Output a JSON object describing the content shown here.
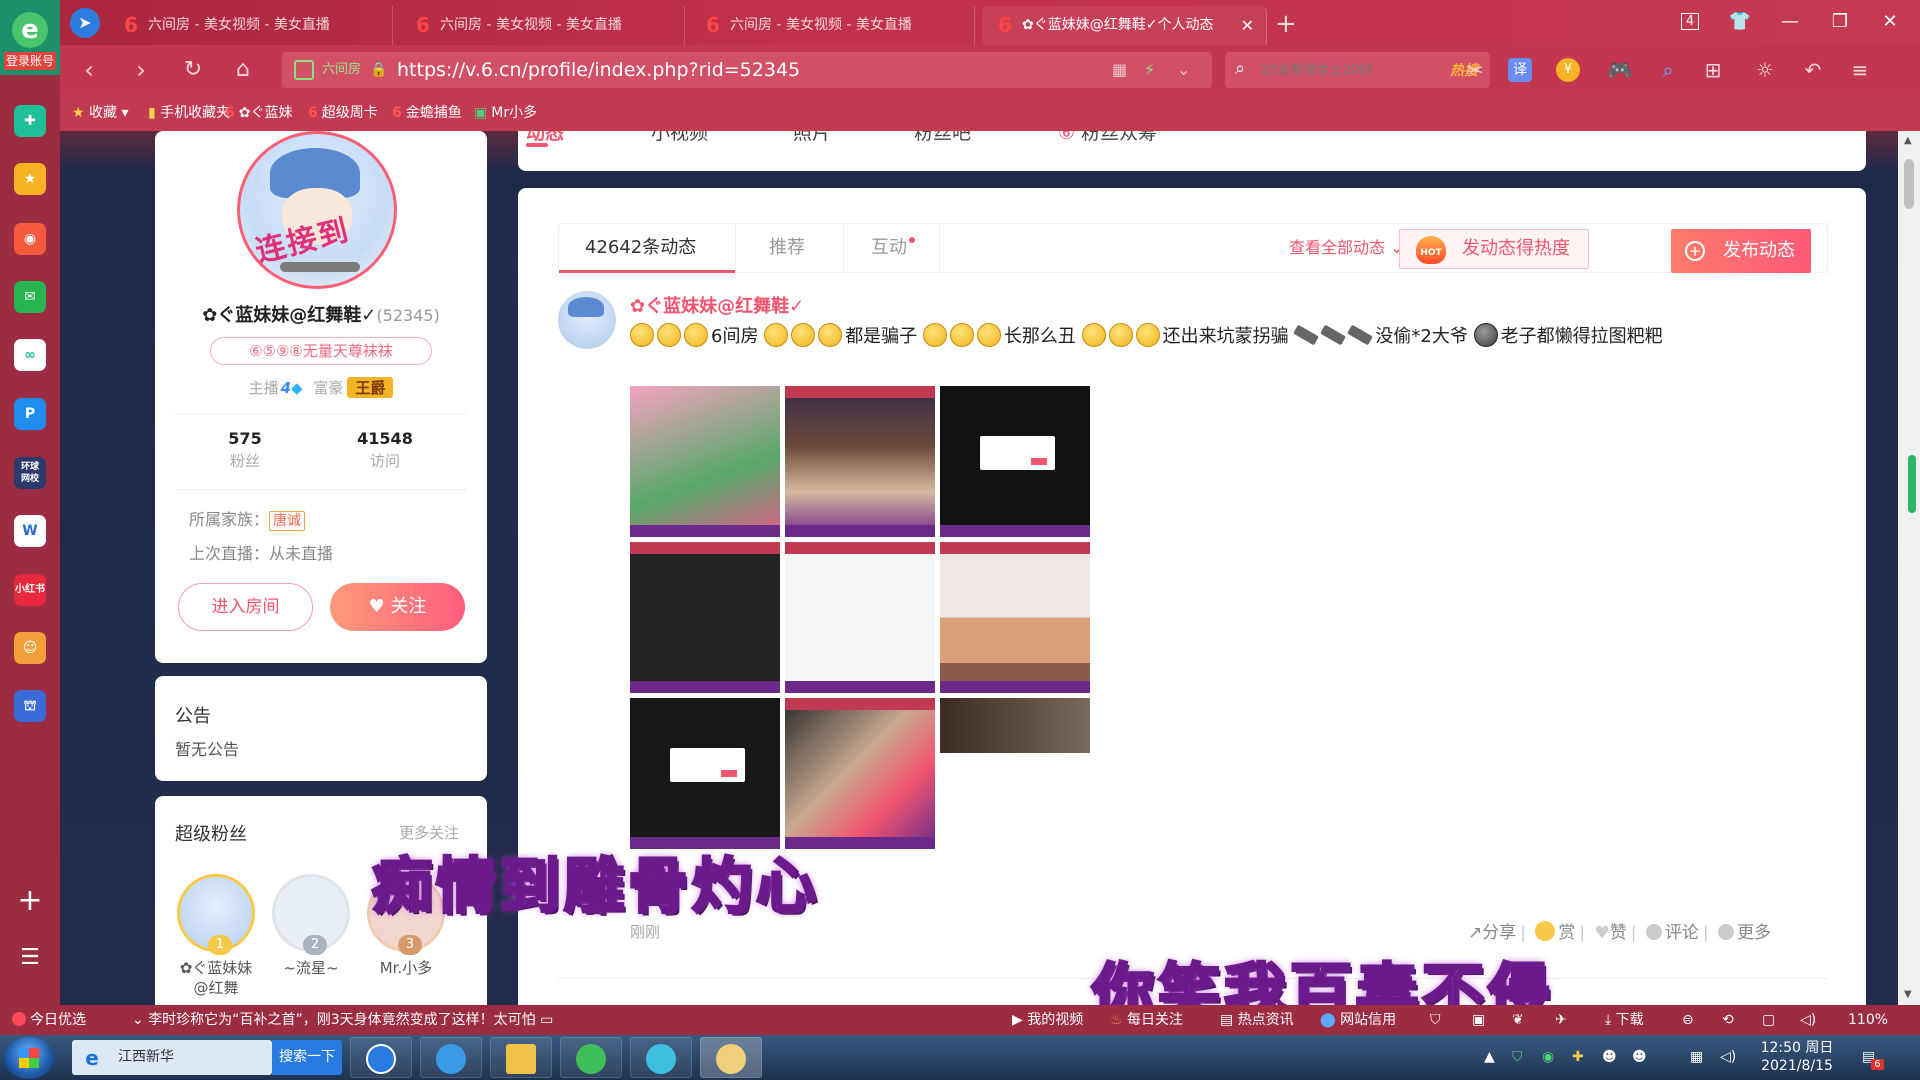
{
  "browser": {
    "login_label": "登录账号",
    "tabs": [
      {
        "title": "六间房 - 美女视频 - 美女直播"
      },
      {
        "title": "六间房 - 美女视频 - 美女直播"
      },
      {
        "title": "六间房 - 美女视频 - 美女直播"
      },
      {
        "title": "✿ぐ蓝妹妹@红舞鞋✓个人动态"
      }
    ],
    "tab_counter": "4",
    "address": {
      "badge": "六间房",
      "url": "https://v.6.cn/profile/index.php?rid=52345"
    },
    "search": {
      "placeholder": "21省新增本土20例",
      "hot_label": "热搜"
    },
    "zoom": "110%",
    "bookmarks": [
      {
        "label": "收藏"
      },
      {
        "label": "手机收藏夹"
      },
      {
        "label": "✿ぐ蓝妹"
      },
      {
        "label": "超级周卡"
      },
      {
        "label": "金蟾捕鱼"
      },
      {
        "label": "Mr小多"
      }
    ]
  },
  "page": {
    "tabs": [
      "动态",
      "小视频",
      "照片",
      "粉丝吧",
      "粉丝众筹"
    ],
    "profile": {
      "name": "✿ぐ蓝妹妹@红舞鞋✓",
      "rid": "(52345)",
      "badge": "⑥⑤⑨⑧无量天尊袜袜",
      "anchor_label": "主播",
      "anchor_level": "4",
      "rich_label": "富豪",
      "rich_level": "王爵",
      "avatar_text": "连接到",
      "stats": [
        {
          "value": "575",
          "label": "粉丝"
        },
        {
          "value": "41548",
          "label": "访问"
        }
      ],
      "family_label": "所属家族：",
      "family_value": "唐诚",
      "last_live_label": "上次直播：从未直播",
      "enter_room": "进入房间",
      "follow": "关注"
    },
    "notice": {
      "title": "公告",
      "text": "暂无公告"
    },
    "super_fans": {
      "title": "超级粉丝",
      "more": "更多关注",
      "fans": [
        {
          "rank": "1",
          "name": "✿ぐ蓝妹妹@红舞"
        },
        {
          "rank": "2",
          "name": "~流星~"
        },
        {
          "rank": "3",
          "name": "Mr.小多"
        }
      ]
    },
    "feed": {
      "tabs": [
        {
          "label": "42642条动态"
        },
        {
          "label": "推荐"
        },
        {
          "label": "互动"
        }
      ],
      "view_all": "查看全部动态",
      "heat_button": "发动态得热度",
      "post_button": "发布动态",
      "post": {
        "author": "✿ぐ蓝妹妹@红舞鞋✓",
        "text_parts": [
          "6间房",
          "都是骗子",
          "长那么丑",
          "还出来坑蒙拐骗",
          "没偷*2大爷",
          "老子都懒得拉图粑粑"
        ],
        "time": "刚刚",
        "actions": [
          "分享",
          "赏",
          "赞",
          "评论",
          "更多"
        ]
      }
    }
  },
  "subtitles": [
    "痴情到雕骨灼心",
    "你笑我百毒不侵"
  ],
  "statusbar": {
    "left": "今日优选",
    "news": "李时珍称它为“百补之首”，刚3天身体竟然变成了这样！太可怕",
    "items": [
      "我的视频",
      "每日关注",
      "热点资讯",
      "网站信用",
      "下载"
    ]
  },
  "taskbar": {
    "search_text": "江西新华",
    "search_button": "搜索一下",
    "clock_time": "12:50 周日",
    "clock_date": "2021/8/15",
    "notif_count": "6"
  },
  "colors": {
    "accent": "#f0566f",
    "browser_red": "#c3364f",
    "sidebar": "#9c2c42"
  }
}
